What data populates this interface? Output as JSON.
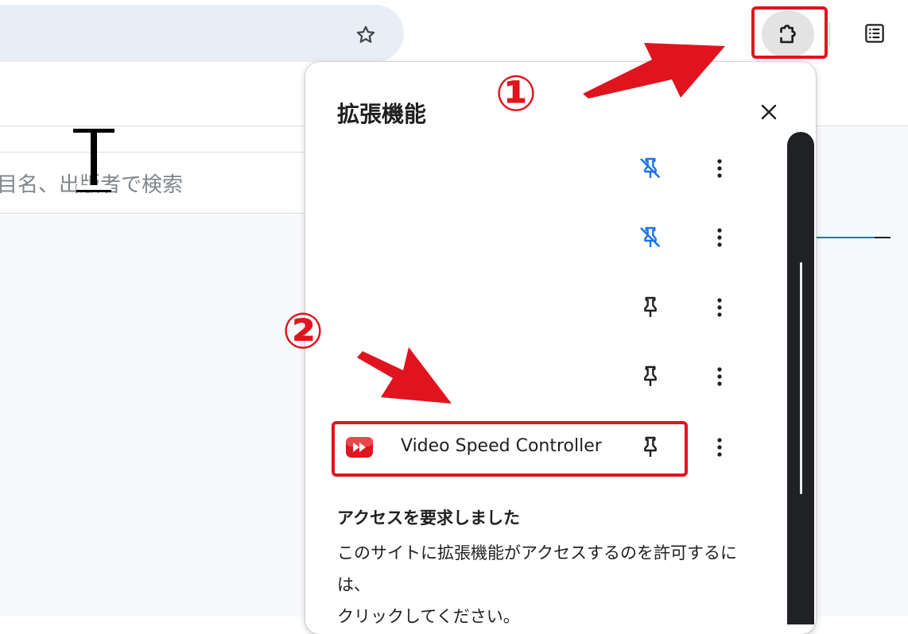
{
  "toolbar": {
    "star_icon": "star-outline-icon",
    "extensions_icon": "puzzle-icon",
    "reading_list_icon": "reading-list-icon"
  },
  "page": {
    "search_placeholder": "目名、出版者で検索"
  },
  "popup": {
    "title": "拡張機能",
    "close_icon": "close-icon",
    "extensions": [
      {
        "name": "",
        "pinned": true
      },
      {
        "name": "",
        "pinned": true
      },
      {
        "name": "",
        "pinned": false
      },
      {
        "name": "",
        "pinned": false
      },
      {
        "name": "Video Speed Controller",
        "pinned": false
      }
    ],
    "access_heading": "アクセスを要求しました",
    "access_line1": "このサイトに拡張機能がアクセスするのを許可するには、",
    "access_line2": "クリックしてください。"
  },
  "annotations": {
    "step1": "①",
    "step2": "②",
    "color": "#e0141e"
  },
  "colors": {
    "accent_blue": "#1a73e8",
    "highlight_red": "#e0141e"
  }
}
